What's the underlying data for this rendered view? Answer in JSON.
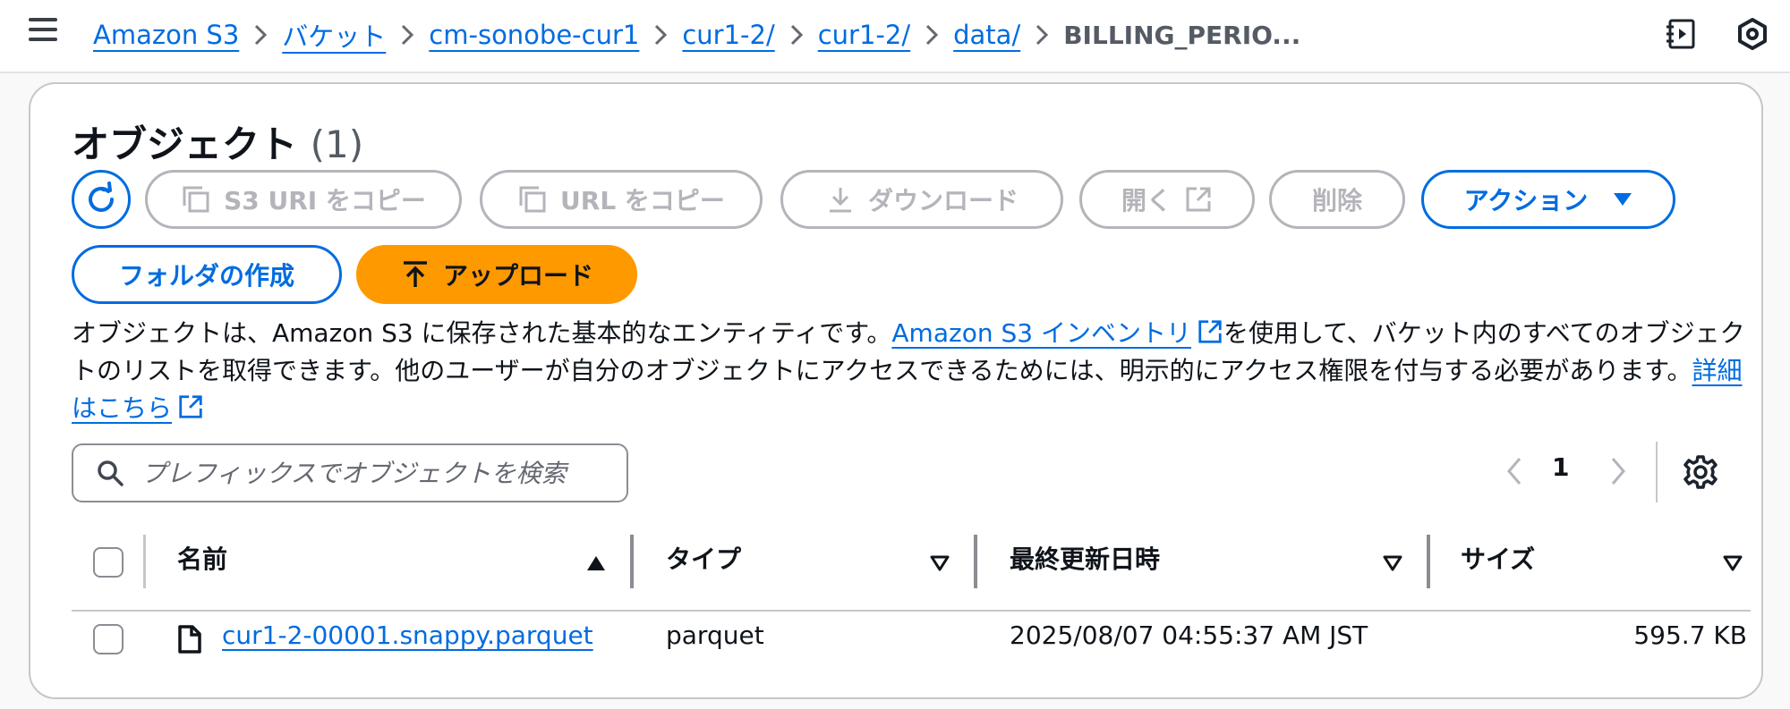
{
  "breadcrumb": {
    "items": [
      "Amazon S3",
      "バケット",
      "cm-sonobe-cur1",
      "cur1-2/",
      "cur1-2/",
      "data/"
    ],
    "current": "BILLING_PERIO..."
  },
  "objects": {
    "title": "オブジェクト",
    "count": "(1)",
    "buttons": {
      "copy_s3_uri": "S3 URI をコピー",
      "copy_url": "URL をコピー",
      "download": "ダウンロード",
      "open": "開く",
      "delete": "削除",
      "actions": "アクション",
      "create_folder": "フォルダの作成",
      "upload": "アップロード"
    },
    "description": {
      "part1": "オブジェクトは、Amazon S3 に保存された基本的なエンティティです。",
      "inventory_link": "Amazon S3 インベントリ",
      "part2": "を使用して、バケット内のすべてのオブジェクトのリストを取得できます。他のユーザーが自分のオブジェクトにアクセスできるためには、明示的にアクセス権限を付与する必要があります。",
      "learn_more_link": "詳細はこちら"
    },
    "search": {
      "placeholder": "プレフィックスでオブジェクトを検索"
    },
    "pagination": {
      "current_page": "1"
    },
    "table": {
      "columns": [
        "名前",
        "タイプ",
        "最終更新日時",
        "サイズ"
      ],
      "rows": [
        {
          "name": "cur1-2-00001.snappy.parquet",
          "type": "parquet",
          "last_modified": "2025/08/07 04:55:37 AM JST",
          "size": "595.7 KB"
        }
      ]
    }
  },
  "colors": {
    "link": "#006ce0",
    "primary": "#ff9900",
    "disabled": "#b4b4bb"
  }
}
